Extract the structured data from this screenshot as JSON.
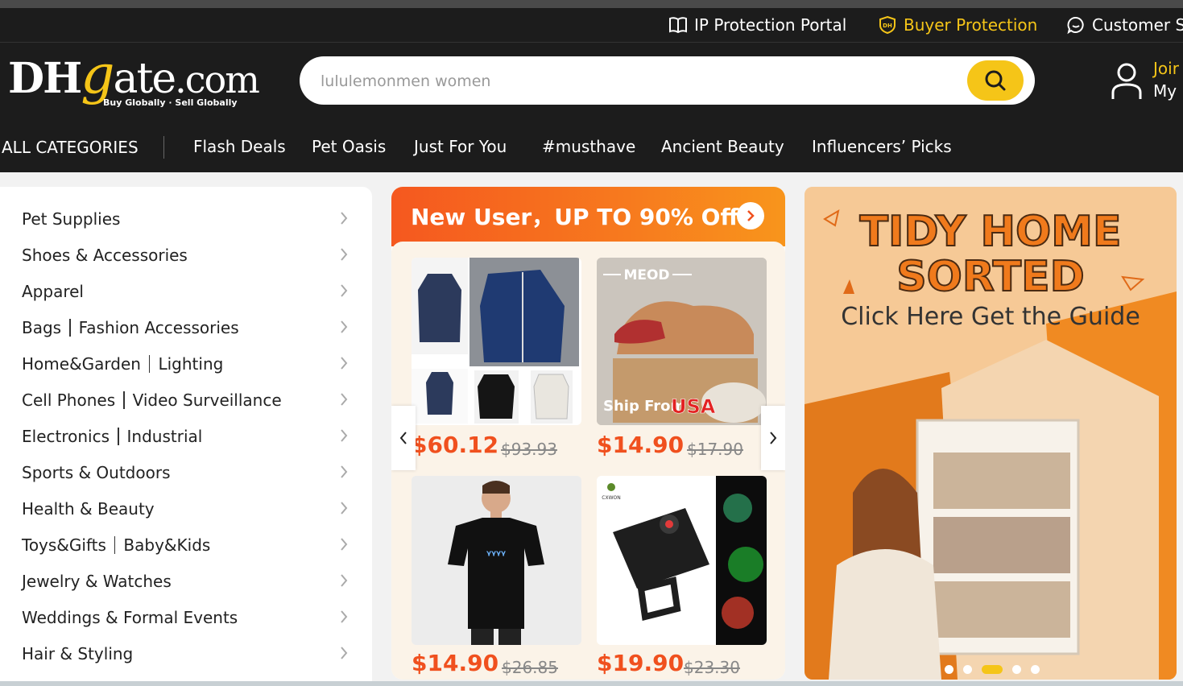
{
  "topbar": {
    "ip_protection": "IP Protection Portal",
    "buyer_protection": "Buyer Protection",
    "customer_service": "Customer S"
  },
  "header": {
    "logo_main_a": "DH",
    "logo_main_g": "g",
    "logo_main_b": "ate",
    "logo_main_c": ".com",
    "logo_tagline": "Buy Globally · Sell Globally",
    "search_value": "lululemonmen women",
    "account_join": "Joir",
    "account_my": "My"
  },
  "nav": {
    "all_categories": "ALL CATEGORIES",
    "items": [
      "Flash Deals",
      "Pet Oasis",
      "Just For You",
      "#musthave",
      "Ancient Beauty",
      "Influencers’ Picks"
    ]
  },
  "sidebar": {
    "categories": [
      {
        "a": "Pet Supplies",
        "b": ""
      },
      {
        "a": "Shoes & Accessories",
        "b": ""
      },
      {
        "a": "Apparel",
        "b": ""
      },
      {
        "a": "Bags",
        "b": "Fashion Accessories"
      },
      {
        "a": "Home&Garden",
        "b": "Lighting"
      },
      {
        "a": "Cell Phones",
        "b": "Video Surveillance"
      },
      {
        "a": "Electronics",
        "b": "Industrial"
      },
      {
        "a": "Sports & Outdoors",
        "b": ""
      },
      {
        "a": "Health & Beauty",
        "b": ""
      },
      {
        "a": "Toys&Gifts",
        "b": "Baby&Kids"
      },
      {
        "a": "Jewelry & Watches",
        "b": ""
      },
      {
        "a": "Weddings & Formal Events",
        "b": ""
      },
      {
        "a": "Hair & Styling",
        "b": ""
      }
    ]
  },
  "promo": {
    "title": "New User，UP TO 90% Off",
    "products": [
      {
        "price": "$60.12",
        "old_price": "$93.93"
      },
      {
        "price": "$14.90",
        "old_price": "$17.90",
        "brand": "MEOD",
        "badge_a": "Ship From",
        "badge_b": "USA"
      },
      {
        "price": "$14.90",
        "old_price": "$26.85"
      },
      {
        "price": "$19.90",
        "old_price": "$23.30",
        "brand": "CXWON"
      }
    ]
  },
  "banner": {
    "line1": "TIDY HOME",
    "line2": "SORTED",
    "subtitle": "Click Here Get the Guide"
  },
  "colors": {
    "accent_yellow": "#f5c518",
    "promo_orange": "#f0501e",
    "dark_bg": "#1c1c1c"
  }
}
